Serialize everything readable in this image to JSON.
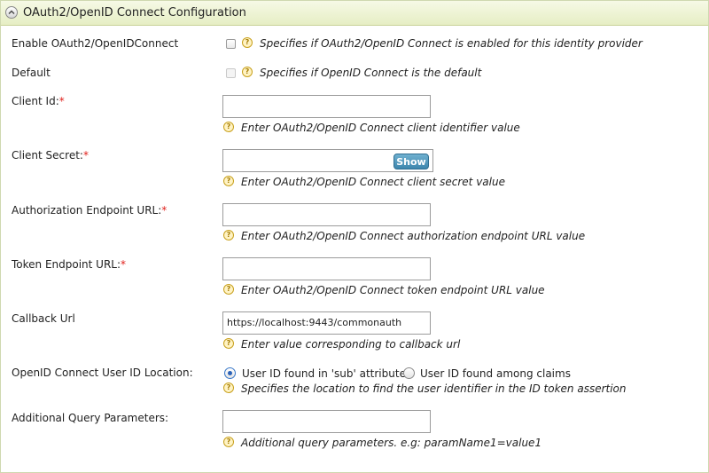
{
  "panel": {
    "title": "OAuth2/OpenID Connect Configuration"
  },
  "fields": {
    "enable": {
      "label": "Enable OAuth2/OpenIDConnect",
      "hint": "Specifies if OAuth2/OpenID Connect is enabled for this identity provider"
    },
    "default": {
      "label": "Default",
      "hint": "Specifies if OpenID Connect is the default"
    },
    "client_id": {
      "label": "Client Id:",
      "required_mark": "*",
      "value": "",
      "hint": "Enter OAuth2/OpenID Connect client identifier value"
    },
    "client_secret": {
      "label": "Client Secret:",
      "required_mark": "*",
      "value": "",
      "show_label": "Show",
      "hint": "Enter OAuth2/OpenID Connect client secret value"
    },
    "auth_endpoint": {
      "label": "Authorization Endpoint URL:",
      "required_mark": "*",
      "value": "",
      "hint": "Enter OAuth2/OpenID Connect authorization endpoint URL value"
    },
    "token_endpoint": {
      "label": "Token Endpoint URL:",
      "required_mark": "*",
      "value": "",
      "hint": "Enter OAuth2/OpenID Connect token endpoint URL value"
    },
    "callback_url": {
      "label": "Callback Url",
      "value": "https://localhost:9443/commonauth",
      "hint": "Enter value corresponding to callback url"
    },
    "user_id_location": {
      "label": "OpenID Connect User ID Location:",
      "options": [
        "User ID found in 'sub' attribute",
        "User ID found among claims"
      ],
      "selected": "User ID found in 'sub' attribute",
      "hint": "Specifies the location to find the user identifier in the ID token assertion"
    },
    "additional_query": {
      "label": "Additional Query Parameters:",
      "value": "",
      "hint": "Additional query parameters. e.g: paramName1=value1"
    }
  },
  "help_glyph": "?",
  "icons": {
    "collapse": "chevron-up-icon",
    "help": "help-icon"
  },
  "colors": {
    "header_bg": "#e6eec4",
    "required": "#e0211c",
    "show_button": "#3d86ad",
    "help": "#c8a01c"
  }
}
